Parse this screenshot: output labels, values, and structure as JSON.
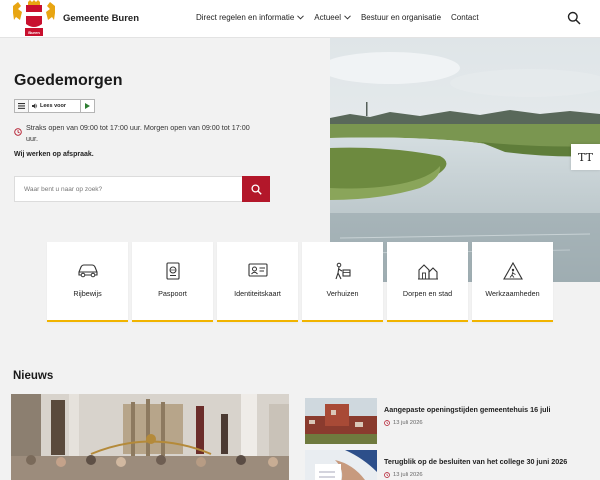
{
  "header": {
    "logo_text": "Buren",
    "site_name": "Gemeente Buren",
    "nav": [
      {
        "label": "Direct regelen en informatie"
      },
      {
        "label": "Actueel"
      },
      {
        "label": "Bestuur en organisatie"
      },
      {
        "label": "Contact"
      }
    ]
  },
  "hero": {
    "greeting": "Goedemorgen",
    "readspeaker_label": "Lees voor",
    "opening_hours": "Straks open van 09:00 tot 17:00 uur. Morgen open van 09:00 tot 17:00 uur.",
    "appointment_note": "Wij werken op afspraak.",
    "search_placeholder": "Waar bent u naar op zoek?",
    "text_size_button": "TT"
  },
  "tiles": [
    {
      "label": "Rijbewijs",
      "icon": "car-icon"
    },
    {
      "label": "Paspoort",
      "icon": "passport-icon"
    },
    {
      "label": "Identiteitskaart",
      "icon": "id-card-icon"
    },
    {
      "label": "Verhuizen",
      "icon": "moving-icon"
    },
    {
      "label": "Dorpen en stad",
      "icon": "village-icon"
    },
    {
      "label": "Werkzaamheden",
      "icon": "roadworks-icon"
    }
  ],
  "news": {
    "title": "Nieuws",
    "items": [
      {
        "title": "Aangepaste openingstijden gemeentehuis 16 juli",
        "date": "13 juli 2026"
      },
      {
        "title": "Terugblik op de besluiten van het college 30 juni 2026",
        "date": "13 juli 2026"
      }
    ]
  },
  "colors": {
    "brand_red": "#b3172a",
    "tile_accent": "#f1b400",
    "background": "#f2f2f2"
  }
}
